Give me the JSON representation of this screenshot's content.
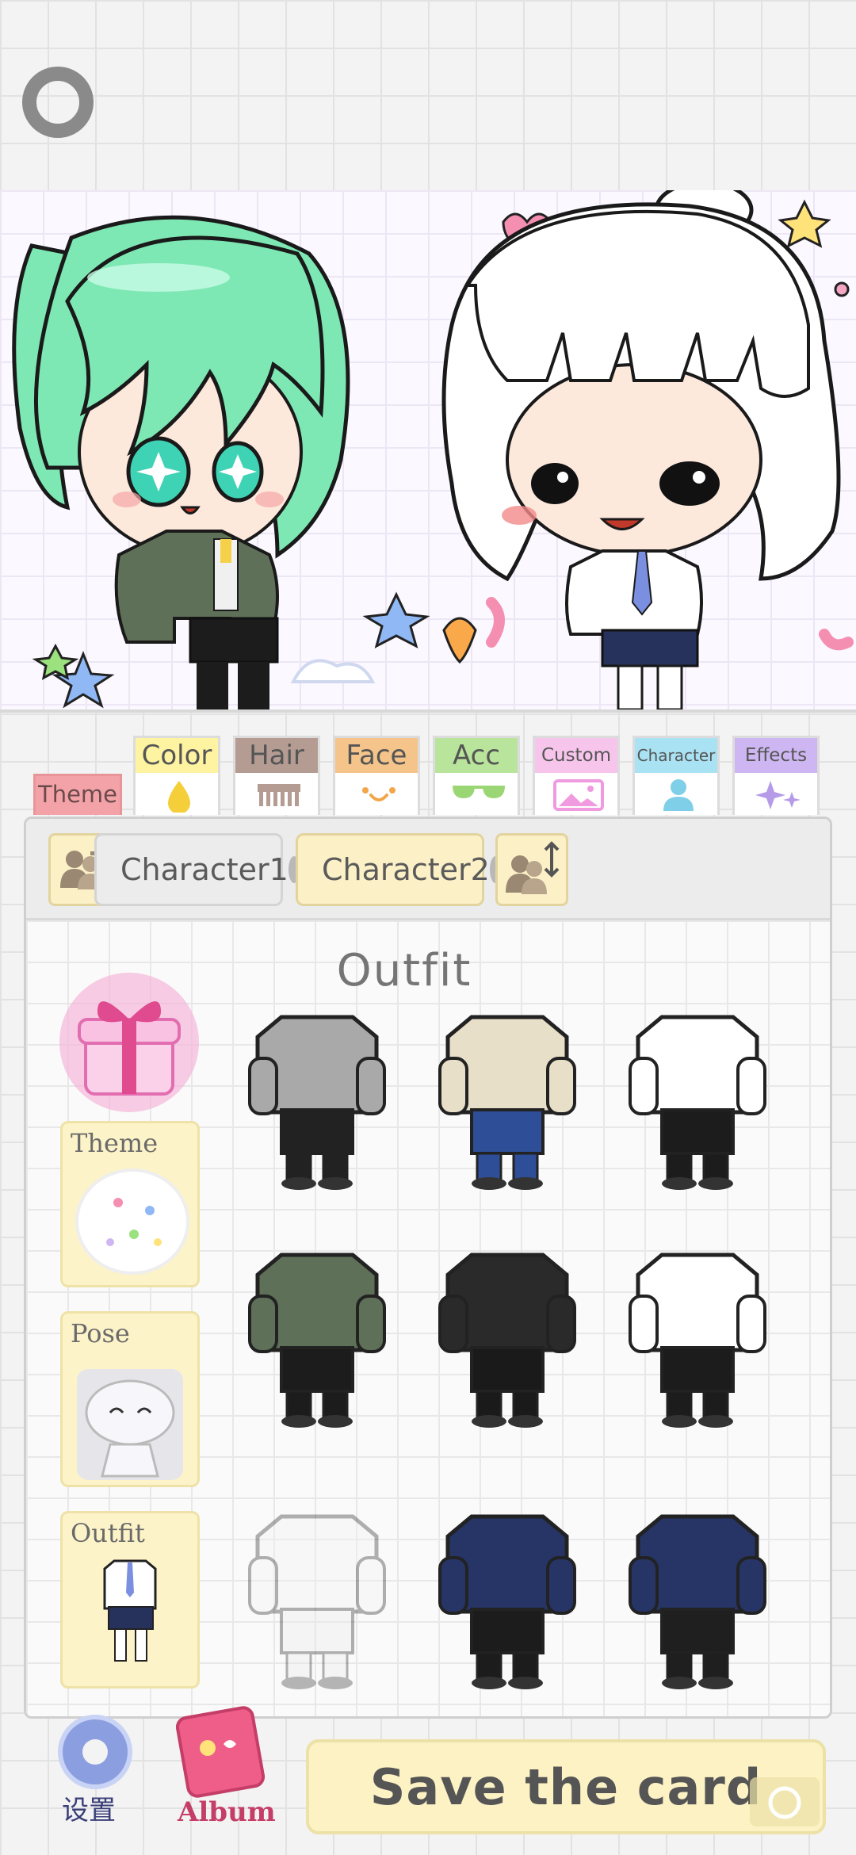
{
  "tabs": [
    {
      "key": "theme",
      "label": "Theme",
      "color": "#f3a3a8"
    },
    {
      "key": "color",
      "label": "Color",
      "color": "#fdf3a0"
    },
    {
      "key": "hair",
      "label": "Hair",
      "color": "#b49c93"
    },
    {
      "key": "face",
      "label": "Face",
      "color": "#f4c48a"
    },
    {
      "key": "acc",
      "label": "Acc",
      "color": "#b8e59b"
    },
    {
      "key": "custom",
      "label": "Custom",
      "color": "#f7c5ec"
    },
    {
      "key": "character",
      "label": "Character",
      "color": "#a9e2f2"
    },
    {
      "key": "effects",
      "label": "Effects",
      "color": "#cdb6f1"
    }
  ],
  "characters": {
    "char1_label": "Character1",
    "char2_label": "Character2"
  },
  "panel": {
    "title": "Outfit"
  },
  "sidebar": {
    "theme_label": "Theme",
    "pose_label": "Pose",
    "outfit_label": "Outfit"
  },
  "bottom": {
    "settings_label": "设置",
    "album_label": "Album",
    "save_label": "Save the card"
  },
  "outfits": [
    {
      "name": "gray-sweater-skirt",
      "top": "#a9a9a9",
      "bottom": "#222222"
    },
    {
      "name": "beige-coat-jeans",
      "top": "#e8dfc9",
      "bottom": "#2e4f98"
    },
    {
      "name": "white-shirt-black-tie",
      "top": "#ffffff",
      "bottom": "#1c1c1c"
    },
    {
      "name": "green-jacket-skirt",
      "top": "#5f7058",
      "bottom": "#1c1c1c"
    },
    {
      "name": "black-coat-tie",
      "top": "#2a2a2a",
      "bottom": "#1a1a1a"
    },
    {
      "name": "white-shirt-blue-tie",
      "top": "#ffffff",
      "bottom": "#1c1c1c"
    },
    {
      "name": "faded-white-shirt",
      "top": "#f2f2f2",
      "bottom": "#eaeaea"
    },
    {
      "name": "navy-blazer-pants",
      "top": "#263566",
      "bottom": "#1c1c1c"
    },
    {
      "name": "navy-blazer-plaid-skirt",
      "top": "#263566",
      "bottom": "#1f1f1f"
    }
  ],
  "colors": {
    "accent": "#fcf2c4",
    "hair_green": "#7ee8b4"
  }
}
